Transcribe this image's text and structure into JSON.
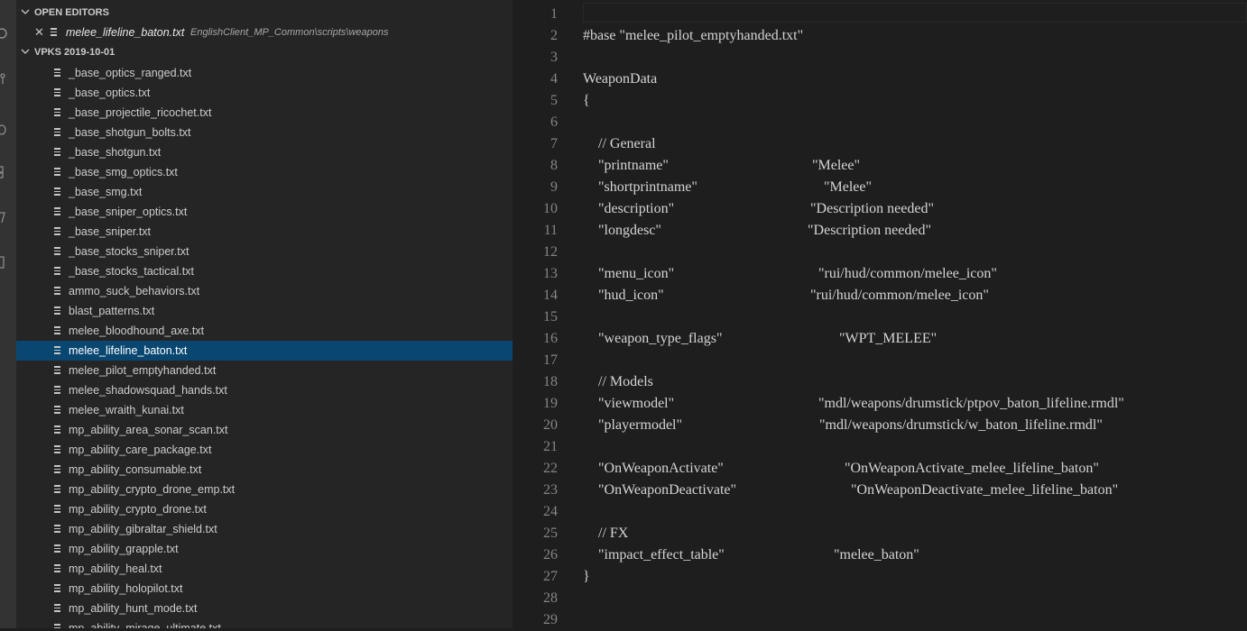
{
  "sidebar": {
    "open_editors_title": "OPEN EDITORS",
    "open_editor": {
      "name": "melee_lifeline_baton.txt",
      "path": "EnglishClient_MP_Common\\scripts\\weapons"
    },
    "vpk_title": "VPKS 2019-10-01",
    "files": [
      "_base_optics_ranged.txt",
      "_base_optics.txt",
      "_base_projectile_ricochet.txt",
      "_base_shotgun_bolts.txt",
      "_base_shotgun.txt",
      "_base_smg_optics.txt",
      "_base_smg.txt",
      "_base_sniper_optics.txt",
      "_base_sniper.txt",
      "_base_stocks_sniper.txt",
      "_base_stocks_tactical.txt",
      "ammo_suck_behaviors.txt",
      "blast_patterns.txt",
      "melee_bloodhound_axe.txt",
      "melee_lifeline_baton.txt",
      "melee_pilot_emptyhanded.txt",
      "melee_shadowsquad_hands.txt",
      "melee_wraith_kunai.txt",
      "mp_ability_area_sonar_scan.txt",
      "mp_ability_care_package.txt",
      "mp_ability_consumable.txt",
      "mp_ability_crypto_drone_emp.txt",
      "mp_ability_crypto_drone.txt",
      "mp_ability_gibraltar_shield.txt",
      "mp_ability_grapple.txt",
      "mp_ability_heal.txt",
      "mp_ability_holopilot.txt",
      "mp_ability_hunt_mode.txt",
      "mp_ability_mirage_ultimate.txt"
    ],
    "selected_file": "melee_lifeline_baton.txt"
  },
  "editor": {
    "lines": [
      {
        "n": "1",
        "text": ""
      },
      {
        "n": "2",
        "text": "#base \"melee_pilot_emptyhanded.txt\""
      },
      {
        "n": "3",
        "text": ""
      },
      {
        "n": "4",
        "text": "WeaponData"
      },
      {
        "n": "5",
        "text": "{"
      },
      {
        "n": "6",
        "text": ""
      },
      {
        "n": "7",
        "key": "// General"
      },
      {
        "n": "8",
        "key": "\"printname\"",
        "value": "\"Melee\""
      },
      {
        "n": "9",
        "key": "\"shortprintname\"",
        "value": "\"Melee\""
      },
      {
        "n": "10",
        "key": "\"description\"",
        "value": "\"Description needed\""
      },
      {
        "n": "11",
        "key": "\"longdesc\"",
        "value": "\"Description needed\""
      },
      {
        "n": "12",
        "text": ""
      },
      {
        "n": "13",
        "key": "\"menu_icon\"",
        "value": "\"rui/hud/common/melee_icon\""
      },
      {
        "n": "14",
        "key": "\"hud_icon\"",
        "value": "\"rui/hud/common/melee_icon\""
      },
      {
        "n": "15",
        "text": ""
      },
      {
        "n": "16",
        "key": "\"weapon_type_flags\"",
        "value": "\"WPT_MELEE\""
      },
      {
        "n": "17",
        "text": ""
      },
      {
        "n": "18",
        "key": "// Models"
      },
      {
        "n": "19",
        "key": "\"viewmodel\"",
        "value": "\"mdl/weapons/drumstick/ptpov_baton_lifeline.rmdl\""
      },
      {
        "n": "20",
        "key": "\"playermodel\"",
        "value": "\"mdl/weapons/drumstick/w_baton_lifeline.rmdl\""
      },
      {
        "n": "21",
        "text": ""
      },
      {
        "n": "22",
        "key": "\"OnWeaponActivate\"",
        "value": "\"OnWeaponActivate_melee_lifeline_baton\""
      },
      {
        "n": "23",
        "key": "\"OnWeaponDeactivate\"",
        "value": "\"OnWeaponDeactivate_melee_lifeline_baton\""
      },
      {
        "n": "24",
        "text": ""
      },
      {
        "n": "25",
        "key": "// FX"
      },
      {
        "n": "26",
        "key": "\"impact_effect_table\"",
        "value": "\"melee_baton\""
      },
      {
        "n": "27",
        "text": "}"
      },
      {
        "n": "28",
        "text": ""
      },
      {
        "n": "29",
        "text": ""
      }
    ]
  }
}
